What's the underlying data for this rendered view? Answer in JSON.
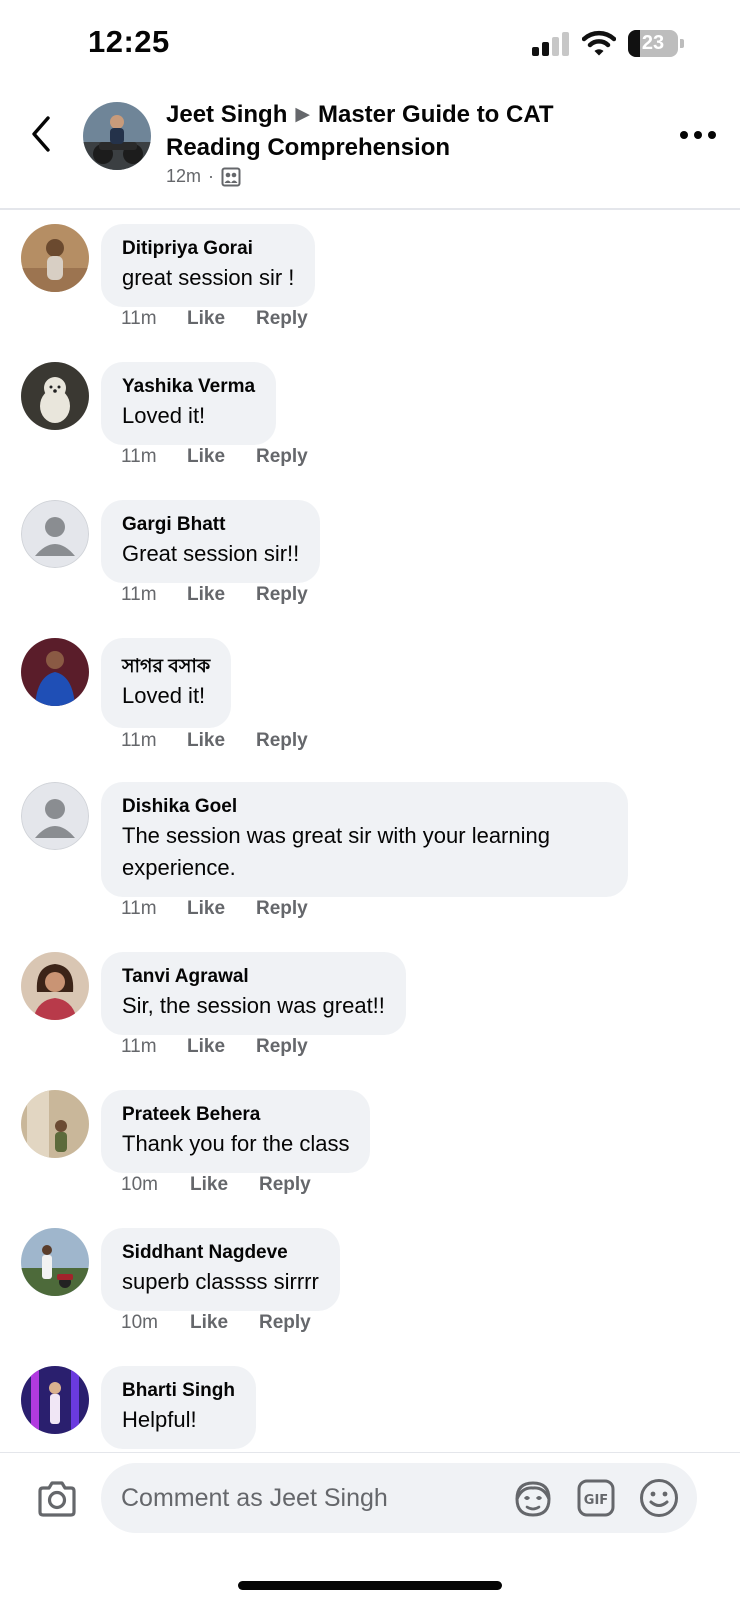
{
  "status_bar": {
    "time": "12:25",
    "battery_level": "23",
    "battery_fraction": 0.23,
    "signal_bars_active": 2,
    "signal_bars_total": 4
  },
  "header": {
    "author": "Jeet Singh",
    "separator_icon": "triangle-right-icon",
    "group": "Master Guide to CAT Reading Comprehension",
    "time": "12m",
    "dot": "·",
    "audience_icon": "group-photo-icon",
    "back_icon": "chevron-left-icon",
    "more_icon": "more-horizontal-icon"
  },
  "comments": [
    {
      "name": "Ditipriya Gorai",
      "text": "great session sir !",
      "time": "11m",
      "like": "Like",
      "reply": "Reply",
      "avatar_colors": [
        "#b58e64",
        "#6b4a2f"
      ]
    },
    {
      "name": "Yashika Verma",
      "text": "Loved it!",
      "time": "11m",
      "like": "Like",
      "reply": "Reply",
      "avatar_colors": [
        "#3a3832",
        "#e9e6dc"
      ]
    },
    {
      "name": "Gargi Bhatt",
      "text": "Great session sir!!",
      "time": "11m",
      "like": "Like",
      "reply": "Reply",
      "avatar_colors": [
        "#e4e6eb",
        "#8a8d91"
      ]
    },
    {
      "name": "সাগর বসাক",
      "text": "Loved it!",
      "time": "11m",
      "like": "Like",
      "reply": "Reply",
      "avatar_colors": [
        "#5a1d2a",
        "#1f4fb6"
      ]
    },
    {
      "name": "Dishika Goel",
      "text": "The session was great sir with your learning experience.",
      "time": "11m",
      "like": "Like",
      "reply": "Reply",
      "avatar_colors": [
        "#e4e6eb",
        "#8a8d91"
      ]
    },
    {
      "name": "Tanvi Agrawal",
      "text": "Sir, the session was great!!",
      "time": "11m",
      "like": "Like",
      "reply": "Reply",
      "avatar_colors": [
        "#d9c6b3",
        "#3c2418"
      ]
    },
    {
      "name": "Prateek Behera",
      "text": "Thank you for the class",
      "time": "10m",
      "like": "Like",
      "reply": "Reply",
      "avatar_colors": [
        "#c9b79a",
        "#5c6a3b"
      ]
    },
    {
      "name": "Siddhant Nagdeve",
      "text": "superb classss sirrrr",
      "time": "10m",
      "like": "Like",
      "reply": "Reply",
      "avatar_colors": [
        "#9fb6cc",
        "#4d6a3a"
      ]
    },
    {
      "name": "Bharti Singh",
      "text": "Helpful!",
      "time": "",
      "like": "",
      "reply": "",
      "avatar_colors": [
        "#2a1f6e",
        "#b13adf"
      ]
    }
  ],
  "composer": {
    "placeholder": "Comment as Jeet Singh",
    "camera_icon": "camera-icon",
    "avatar_sticker_icon": "avatar-sticker-icon",
    "gif_icon": "gif-icon",
    "emoji_icon": "smiley-icon"
  },
  "colors": {
    "bubble": "#f0f2f5",
    "secondary_text": "#65676b",
    "primary_text": "#050505",
    "divider": "#e4e6eb"
  }
}
